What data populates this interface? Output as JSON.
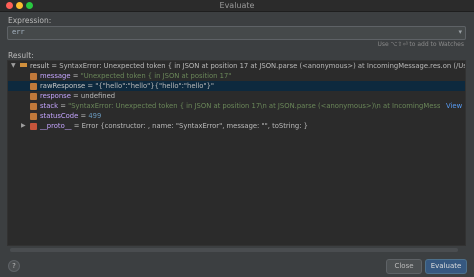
{
  "window": {
    "title": "Evaluate"
  },
  "expression": {
    "label": "Expression:",
    "value": "err"
  },
  "hint": "Use ⌥⇧⏎ to add to Watches",
  "result": {
    "label": "Result:",
    "rows": [
      {
        "name": "result",
        "eq": " = ",
        "value": "SyntaxError: Unexpected token { in JSON at position 17    at JSON.parse (<anonymous>)    at IncomingMessage.res.on (/Users/gk"
      },
      {
        "name": "message",
        "eq": " = ",
        "value": "\"Unexpected token { in JSON at position 17\""
      },
      {
        "name": "rawResponse",
        "eq": " = ",
        "value": "\"{\"hello\":\"hello\"}{\"hello\":\"hello\"}\""
      },
      {
        "name": "response",
        "eq": " = ",
        "value": "undefined"
      },
      {
        "name": "stack",
        "eq": " = ",
        "value": "\"SyntaxError: Unexpected token { in JSON at position 17\\n    at JSON.parse (<anonymous>)\\n    at IncomingMessage.res.on",
        "link": "View"
      },
      {
        "name": "statusCode",
        "eq": " = ",
        "value": "499"
      },
      {
        "name": "__proto__",
        "eq": " = ",
        "value": "Error {constructor: , name: \"SyntaxError\", message: \"\", toString: }"
      }
    ]
  },
  "buttons": {
    "help": "?",
    "close": "Close",
    "evaluate": "Evaluate"
  }
}
